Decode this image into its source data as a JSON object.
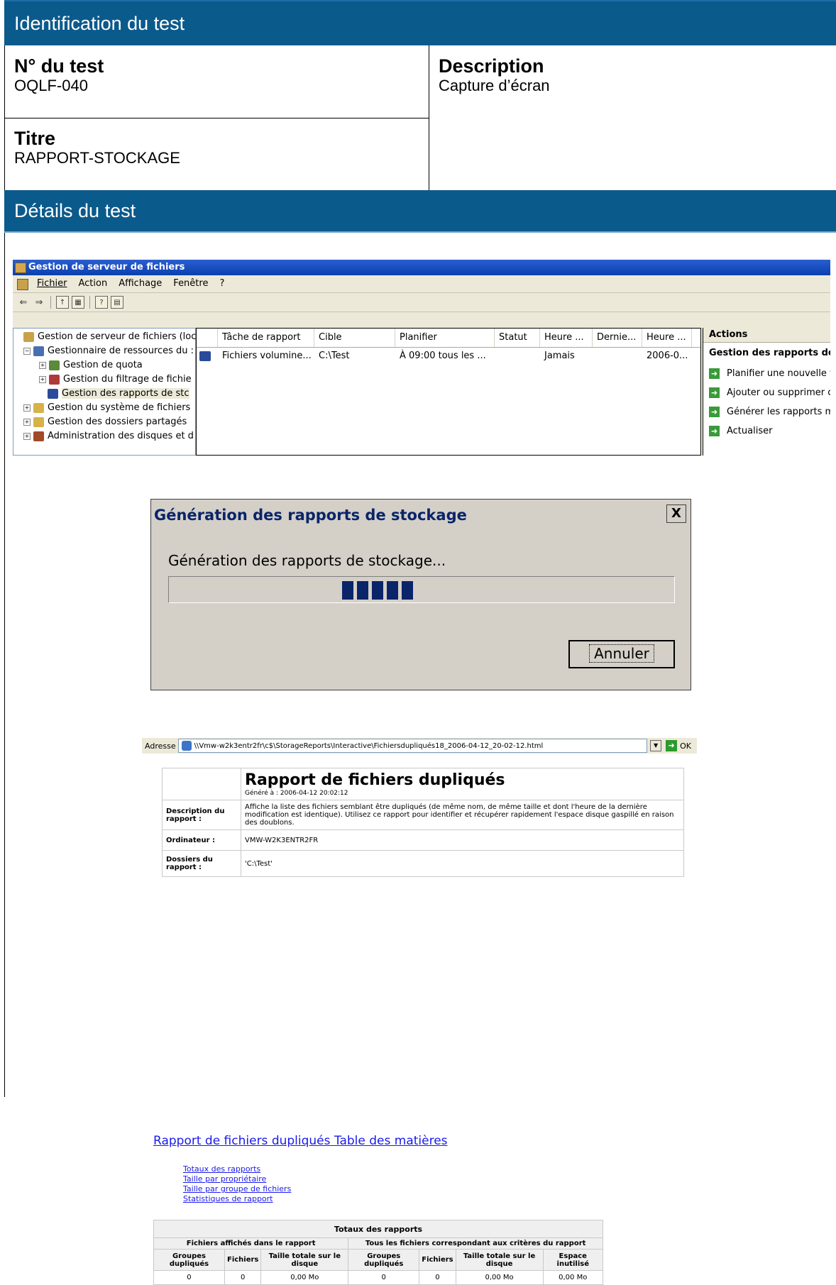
{
  "header": {
    "identification_title": "Identification du test",
    "test_number_label": "N° du test",
    "test_number_value": "OQLF-040",
    "description_label": "Description",
    "description_value": "Capture d’écran",
    "titre_label": "Titre",
    "titre_value": "RAPPORT-STOCKAGE",
    "details_title": "Détails du test"
  },
  "mmc": {
    "window_title": "Gestion de serveur de fichiers",
    "menu": [
      "Fichier",
      "Action",
      "Affichage",
      "Fenêtre",
      "?"
    ],
    "tree": [
      "Gestion de serveur de fichiers (loca",
      "Gestionnaire de ressources du :",
      "Gestion de quota",
      "Gestion du filtrage de fichie",
      "Gestion des rapports de stc",
      "Gestion du système de fichiers",
      "Gestion des dossiers partagés",
      "Administration des disques et d"
    ],
    "columns": [
      "Tâche de rapport",
      "Cible",
      "Planifier",
      "Statut",
      "Heure ...",
      "Dernie...",
      "Heure ..."
    ],
    "rows": [
      [
        "Fichiers volumine...",
        "C:\\Test",
        "À 09:00 tous les ...",
        "",
        "Jamais",
        "",
        "2006-0..."
      ]
    ],
    "actions_header": "Actions",
    "actions_section": "Gestion des rapports de",
    "actions": [
      "Planifier une nouvelle t",
      "Ajouter ou supprimer c",
      "Générer les rapports m",
      "Actualiser"
    ]
  },
  "dialog": {
    "title": "Génération des rapports de stockage",
    "close": "X",
    "message": "Génération des rapports de stockage...",
    "cancel": "Annuler",
    "progress_blocks": 5
  },
  "browser": {
    "address_label": "Adresse",
    "address_value": "\\\\Vmw-w2k3entr2fr\\c$\\StorageReports\\Interactive\\Fichiersdupliqués18_2006-04-12_20-02-12.html",
    "go": "OK"
  },
  "report": {
    "title": "Rapport de fichiers dupliqués",
    "generated": "Généré à : 2006-04-12 20:02:12",
    "desc_label": "Description du rapport :",
    "desc_value": "Affiche la liste des fichiers semblant être dupliqués (de même nom, de même taille et dont l'heure de la dernière modification est identique). Utilisez ce rapport pour identifier et récupérer rapidement l'espace disque gaspillé en raison des doublons.",
    "computer_label": "Ordinateur :",
    "computer_value": "VMW-W2K3ENTR2FR",
    "folders_label": "Dossiers du rapport :",
    "folders_value": "'C:\\Test'",
    "toc_title": "Rapport de fichiers dupliqués Table des matières",
    "toc_links": [
      "Totaux des rapports",
      "Taille par propriétaire",
      "Taille par groupe de fichiers",
      "Statistiques de rapport"
    ],
    "totals_title": "Totaux des rapports",
    "group1": "Fichiers affichés dans le rapport",
    "group2": "Tous les fichiers correspondant aux critères du rapport",
    "cols": [
      "Groupes dupliqués",
      "Fichiers",
      "Taille totale sur le disque",
      "Groupes dupliqués",
      "Fichiers",
      "Taille totale sur le disque",
      "Espace inutilisé"
    ],
    "values": [
      "0",
      "0",
      "0,00 Mo",
      "0",
      "0",
      "0,00 Mo",
      "0,00 Mo"
    ]
  }
}
